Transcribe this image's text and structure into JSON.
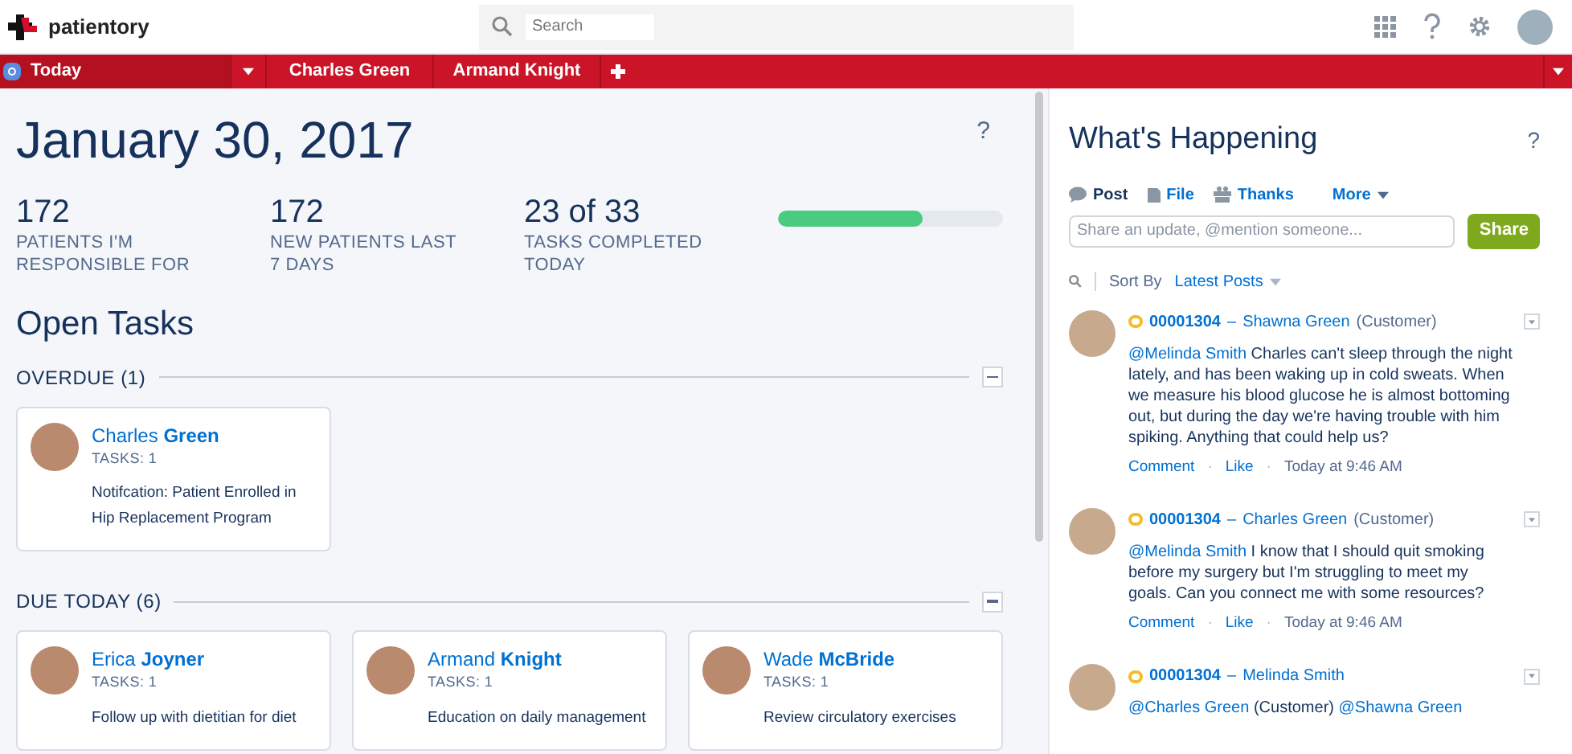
{
  "header": {
    "logo": "patientory",
    "search": {
      "placeholder": "Search"
    }
  },
  "tabs": [
    {
      "label": "Today",
      "selected": true,
      "kind": "home"
    },
    {
      "label": "Charles Green",
      "selected": false,
      "kind": "record"
    },
    {
      "label": "Armand Knight",
      "selected": false,
      "kind": "record"
    }
  ],
  "main": {
    "date": "January 30, 2017",
    "help": "?",
    "stats": [
      {
        "value": "172",
        "label": "PATIENTS I'M RESPONSIBLE FOR"
      },
      {
        "value": "172",
        "label": "NEW PATIENTS LAST 7 DAYS"
      },
      {
        "value": "23 of 33",
        "label": "TASKS COMPLETED TODAY",
        "level": 0.64
      }
    ],
    "open_tasks_title": "Open Tasks",
    "groups": [
      {
        "title": "OVERDUE (1)",
        "expanded": true,
        "cards": [
          {
            "name": "Charles **Green**",
            "tasks": "TASKS: 1",
            "note": "Notifcation: Patient Enrolled in Hip Replacement Program"
          }
        ]
      },
      {
        "title": "DUE TODAY (6)",
        "expanded": true,
        "cards": [
          {
            "name": "Erica **Joyner**",
            "tasks": "TASKS: 1",
            "note": "Follow up with dietitian for diet"
          },
          {
            "name": "Armand **Knight**",
            "tasks": "TASKS: 1",
            "note": "Education on daily management"
          },
          {
            "name": "Wade **McBride**",
            "tasks": "TASKS: 1",
            "note": "Review circulatory exercises"
          }
        ]
      }
    ]
  },
  "feed": {
    "title": "What's Happening",
    "help": "?",
    "publisher_tabs": [
      {
        "label": "Post",
        "selected": true,
        "kind": "post"
      },
      {
        "label": "File",
        "selected": false,
        "kind": "file"
      },
      {
        "label": "Thanks",
        "selected": false,
        "kind": "thanks"
      },
      {
        "label": "More",
        "selected": false,
        "kind": "more"
      }
    ],
    "input": {
      "placeholder": "Share an update, @mention someone..."
    },
    "share": "Share",
    "sort_label": "Sort By",
    "sort_value": "Latest Posts",
    "posts": [
      {
        "case": "00001304",
        "dash": "–",
        "author": "Shawna Green",
        "role": "(Customer)",
        "dots": [
          "·",
          "·"
        ],
        "body": [
          {
            "kind": "mention",
            "text": "@Melinda Smith"
          },
          {
            "kind": "text",
            "text": "Charles can't sleep through the night lately, and has been waking up in cold sweats. When we measure his blood glucose he is almost bottoming out, but during the day we're having trouble with him spiking. Anything that could help us?"
          }
        ],
        "actions": [
          "Comment",
          "Like"
        ],
        "time": "Today at 9:46 AM"
      },
      {
        "case": "00001304",
        "dash": "–",
        "author": "Charles Green",
        "role": "(Customer)",
        "dots": [
          "·",
          "·"
        ],
        "body": [
          {
            "kind": "mention",
            "text": "@Melinda Smith"
          },
          {
            "kind": "text",
            "text": "I know that I should quit smoking before my surgery but I'm struggling to meet my goals. Can you connect me with some resources?"
          }
        ],
        "actions": [
          "Comment",
          "Like"
        ],
        "time": "Today at 9:46 AM"
      },
      {
        "case": "00001304",
        "dash": "–",
        "author": "Melinda Smith",
        "body": [
          {
            "kind": "mention",
            "text": "@Charles Green"
          },
          {
            "kind": "text",
            "text": "(Customer)"
          },
          {
            "kind": "mention",
            "text": "@Shawna Green"
          }
        ]
      }
    ]
  }
}
